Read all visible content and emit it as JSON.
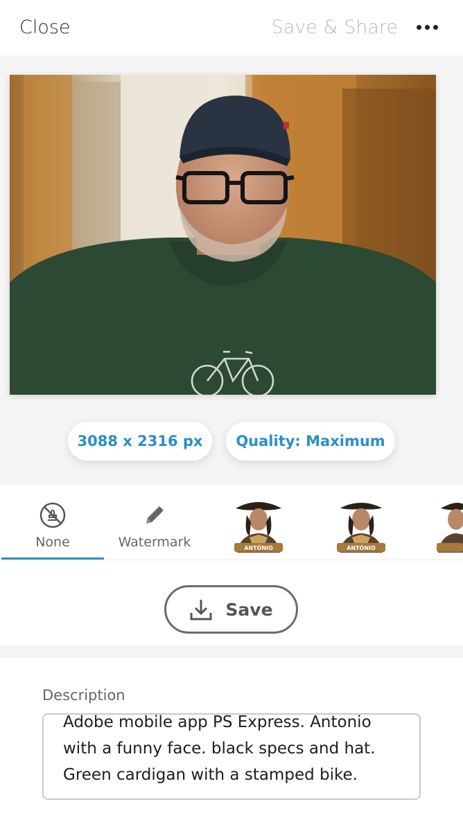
{
  "topbar": {
    "close_label": "Close",
    "save_share_label": "Save & Share",
    "more_icon": "more-horizontal-icon"
  },
  "image_info": {
    "dimensions": "3088 x 2316 px",
    "quality": "Quality: Maximum"
  },
  "watermarks": {
    "items": [
      {
        "label": "None",
        "icon": "no-stamp-icon",
        "selected": true
      },
      {
        "label": "Watermark",
        "icon": "pencil-icon",
        "selected": false
      }
    ],
    "sticker_text": "ANTÓNIO"
  },
  "save": {
    "label": "Save",
    "icon": "download-icon"
  },
  "description": {
    "label": "Description",
    "text": "Adobe mobile app PS Express. Antonio with a funny face.  black  specs and hat. Green cardigan with a stamped bike."
  },
  "colors": {
    "accent": "#2a8fc9",
    "text": "#2c2c2c",
    "disabled": "#b8b8b8"
  }
}
